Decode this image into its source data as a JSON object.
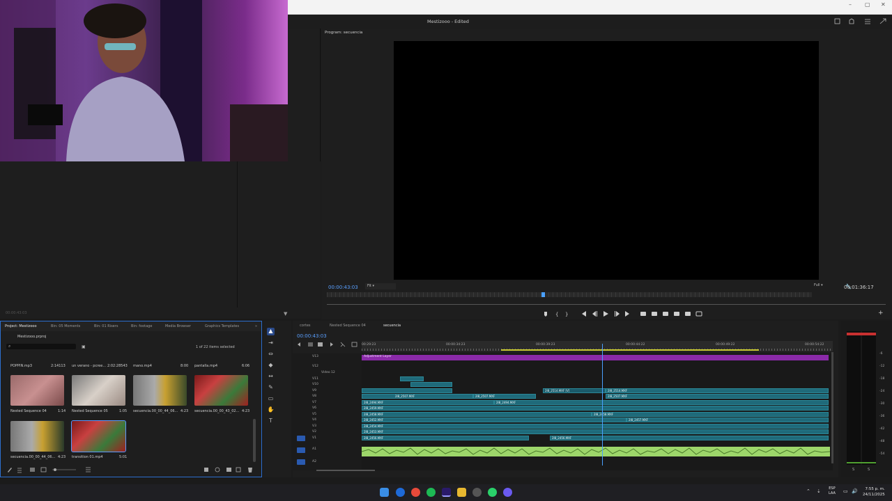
{
  "window": {
    "title": "Mestizooo - Edited",
    "min": "–",
    "max": "▢",
    "close": "✕"
  },
  "program": {
    "panel_title": "Program: secuencia",
    "timecode": "00:00:43:03",
    "fit": "Fit",
    "resolution": "Full",
    "duration": "00:01:36:17"
  },
  "project": {
    "tabs": [
      "Project: Mestizooo",
      "Bin: 05 Moments",
      "Bin: 01 Risers",
      "Bin: footage",
      "Media Browser",
      "Graphics Templates"
    ],
    "file": "Mestizooo.prproj",
    "count": "1 of 22 items selected",
    "top_items": [
      {
        "name": "POPPIN.mp3",
        "dur": "2:14113"
      },
      {
        "name": "un verano - pcree...",
        "dur": "2:02:28543"
      },
      {
        "name": "mano.mp4",
        "dur": "8:00"
      },
      {
        "name": "pantalla.mp4",
        "dur": "6:06"
      }
    ],
    "items": [
      {
        "name": "Nested Sequence 04",
        "dur": "1:14"
      },
      {
        "name": "Nested Sequence 05",
        "dur": "1:05"
      },
      {
        "name": "secuencia.00_00_44_06...",
        "dur": "4:23"
      },
      {
        "name": "secuencia.00_00_43_02...",
        "dur": "4:23"
      },
      {
        "name": "secuencia.00_00_44_06...",
        "dur": "4:23"
      },
      {
        "name": "transition 01.mp4",
        "dur": "5:01"
      }
    ],
    "footer_tc": "00:00:43:03"
  },
  "timeline": {
    "tabs": [
      "cortes",
      "Nested Sequence 04",
      "secuencia"
    ],
    "timecode": "00:00:43:03",
    "ruler": [
      "00:29:23",
      "00:00:34:23",
      "00:00:39:23",
      "00:00:44:22",
      "00:00:49:22",
      "00:00:54:22"
    ],
    "tracks": [
      "V13",
      "V12",
      "Video 12",
      "V11",
      "V10",
      "V9",
      "V8",
      "V7",
      "V6",
      "V5",
      "V4",
      "V3",
      "V2",
      "V1",
      "A1",
      "A2"
    ],
    "adjustment": "Adjustment Layer",
    "clips": {
      "c1": "2I8_2507.MXF",
      "c2": "2I8_2514.MXF [V]",
      "c3": "2I8_2494.MXF",
      "c4": "2I8_2459.MXF",
      "c5": "2I8_2458.MXF",
      "c6": "2I8_2452.MXF",
      "c7": "2I8_2454.MXF",
      "c8": "2I8_2456.MXF",
      "c9": "2I8_2453.MXF",
      "c10": "2I8_2457.MXF",
      "c11": "2I8_2514.MXF",
      "c12": "2I8_2507.MXF",
      "c13": "2I8_2494.MXF",
      "c14": "2I8_2458.MXF",
      "c15": "2I8_2456.MXF"
    }
  },
  "meters": [
    "-6",
    "-12",
    "-18",
    "-24",
    "-30",
    "-36",
    "-42",
    "-48",
    "-54"
  ],
  "meters_footer": [
    "S",
    "S"
  ],
  "taskbar": {
    "lang": "ESP",
    "region": "LAA",
    "time": "7:55 p. m.",
    "date": "24/11/2025"
  }
}
